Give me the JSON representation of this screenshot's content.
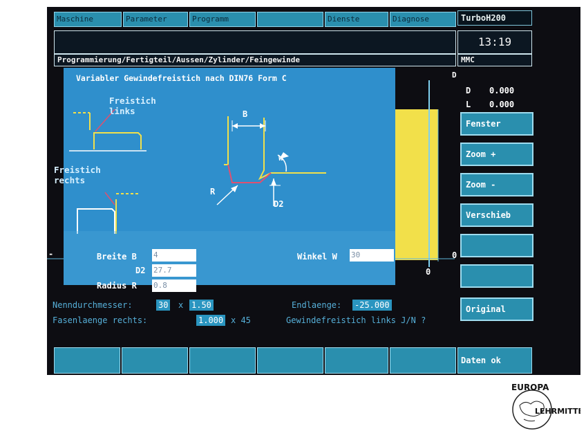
{
  "menu": [
    "Maschine",
    "Parameter",
    "Programm",
    "",
    "Dienste",
    "Diagnose"
  ],
  "brand": "TurboH200",
  "clock": "13:19",
  "path": "Programmierung/Fertigteil/Aussen/Zylinder/Feingewinde",
  "mode": "MMC",
  "dialog": {
    "title": "Variabler Gewindefreistich nach DIN76 Form C",
    "left_label": "Freistich links",
    "right_label": "Freistich rechts",
    "dim_b": "B",
    "dim_w": "W",
    "dim_r": "R",
    "dim_d2": "D2",
    "fields": {
      "breite_label": "Breite B",
      "breite_value": "4",
      "d2_label": "D2",
      "d2_value": "27.7",
      "radius_label": "Radius R",
      "radius_value": "0.8",
      "winkel_label": "Winkel W",
      "winkel_value": "30"
    }
  },
  "axis": {
    "top": "D",
    "zero_right": "0",
    "zero_bottom": "0",
    "minus": "-"
  },
  "coords": [
    {
      "axis": "D",
      "value": "0.000"
    },
    {
      "axis": "L",
      "value": "0.000"
    }
  ],
  "softkeys": [
    "Fenster",
    "Zoom +",
    "Zoom -",
    "Verschieb",
    "",
    "",
    "Original"
  ],
  "bottom": {
    "nenn_label": "Nenndurchmesser:",
    "nenn_value1": "30",
    "times": "x",
    "nenn_value2": "1.50",
    "end_label": "Endlaenge:",
    "end_value": "-25.000",
    "fasen_label": "Fasenlaenge rechts:",
    "fasen_value": "1.000",
    "fasen_suffix": "x 45",
    "question": "Gewindefreistich links J/N ?"
  },
  "hkeys": [
    "",
    "",
    "",
    "",
    "",
    "",
    "Daten ok"
  ],
  "logo": {
    "top": "EUROPA",
    "bottom": "LEHRMITTEL"
  },
  "colors": {
    "accent": "#2a8fae",
    "dialog": "#2f8fcc",
    "yellow": "#f2e04a",
    "text": "#56b0d9"
  }
}
